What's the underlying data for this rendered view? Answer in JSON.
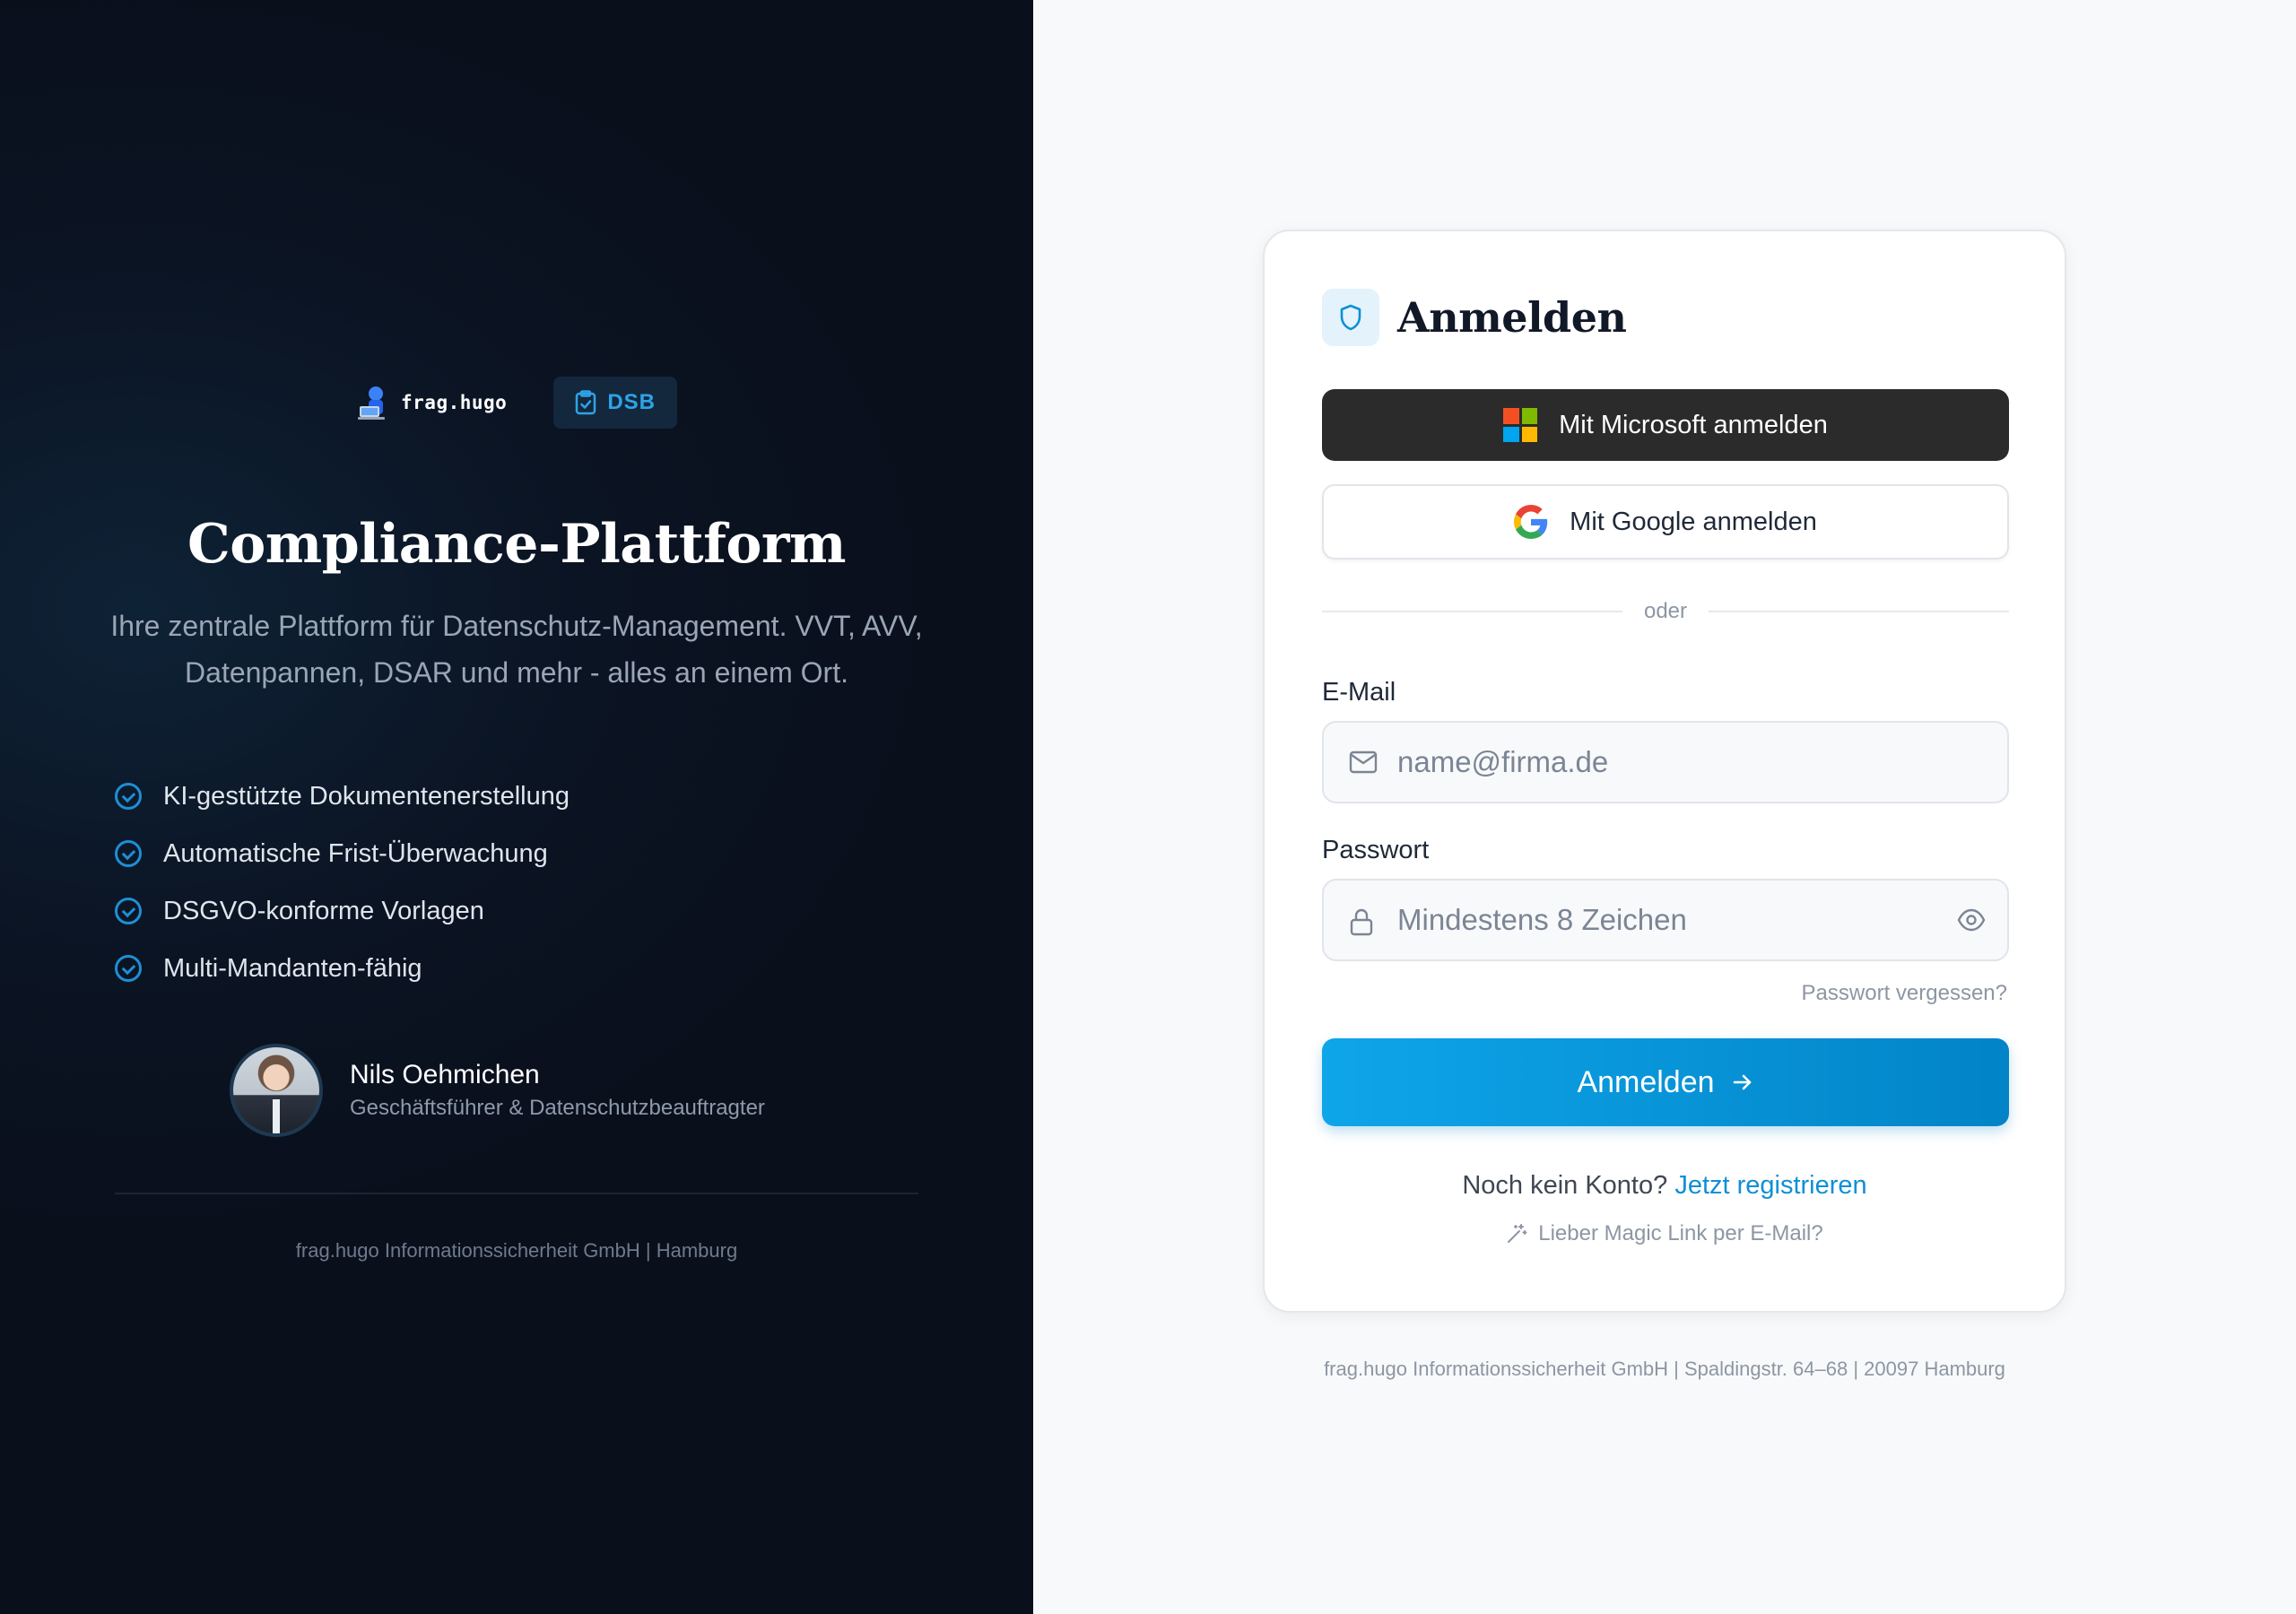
{
  "brand": {
    "logo_text": "frag.hugo",
    "badge": "DSB"
  },
  "hero": {
    "title": "Compliance-Plattform",
    "subtitle": "Ihre zentrale Plattform für Datenschutz-Management. VVT, AVV, Datenpannen, DSAR und mehr - alles an einem Ort."
  },
  "features": [
    "KI-gestützte Dokumentenerstellung",
    "Automatische Frist-Überwachung",
    "DSGVO-konforme Vorlagen",
    "Multi-Mandanten-fähig"
  ],
  "person": {
    "name": "Nils Oehmichen",
    "role": "Geschäftsführer & Datenschutzbeauftragter"
  },
  "left_footer": "frag.hugo Informationssicherheit GmbH | Hamburg",
  "login": {
    "title": "Anmelden",
    "microsoft_label": "Mit Microsoft anmelden",
    "google_label": "Mit Google anmelden",
    "divider": "oder",
    "email_label": "E-Mail",
    "email_placeholder": "name@firma.de",
    "password_label": "Passwort",
    "password_placeholder": "Mindestens 8 Zeichen",
    "forgot": "Passwort vergessen?",
    "submit": "Anmelden",
    "no_account": "Noch kein Konto?",
    "register": "Jetzt registrieren",
    "magic_link": "Lieber Magic Link per E-Mail?"
  },
  "right_footer": "frag.hugo Informationssicherheit GmbH | Spaldingstr. 64–68 | 20097 Hamburg",
  "colors": {
    "left_bg": "#0a0f1c",
    "accent": "#0ea5e9",
    "accent_dark": "#0284c7",
    "microsoft_button": "#2b2b2b",
    "right_bg": "#f8f9fb"
  },
  "icons": {
    "badge": "clipboard-check-icon",
    "feature": "check-circle-icon",
    "card_header": "shield-icon",
    "email": "mail-icon",
    "password": "lock-icon",
    "toggle": "eye-icon",
    "submit": "arrow-right-icon",
    "magic": "magic-wand-icon"
  }
}
